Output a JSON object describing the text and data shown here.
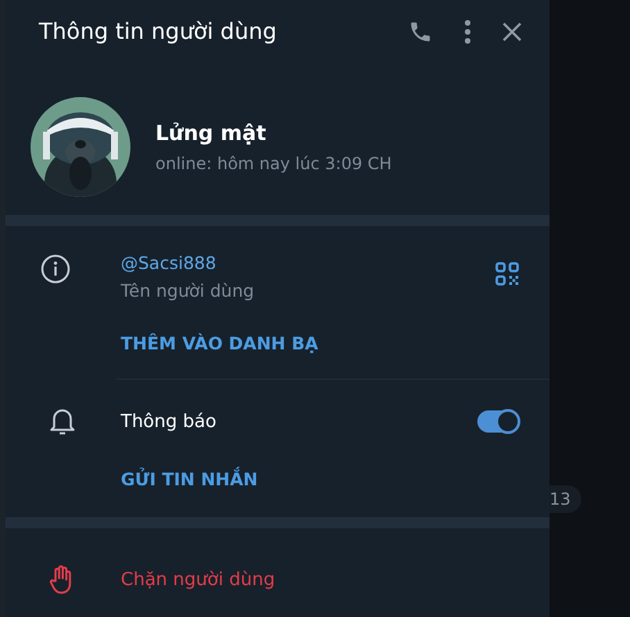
{
  "window": {
    "title": "Thông tin người dùng"
  },
  "profile": {
    "name": "Lửng mật",
    "status": "online: hôm nay lúc 3:09 CH"
  },
  "info": {
    "username": "@Sacsi888",
    "username_label": "Tên người dùng",
    "add_contact": "THÊM VÀO DANH BẠ"
  },
  "notifications": {
    "label": "Thông báo",
    "on": true
  },
  "send_message": "GỬI TIN NHẮN",
  "block": "Chặn người dùng",
  "background": {
    "badge": "13"
  }
}
